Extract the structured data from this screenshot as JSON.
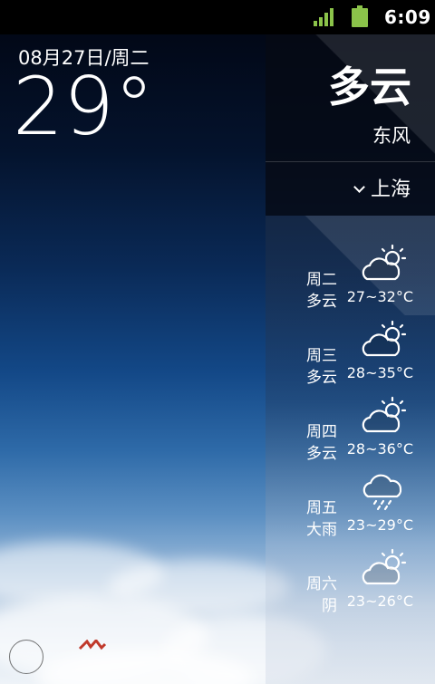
{
  "status_bar": {
    "time": "6:09",
    "signal_icon": "signal-bars-icon",
    "battery_icon": "battery-icon"
  },
  "current": {
    "date": "08月27日/周二",
    "temperature": "29°",
    "condition": "多云",
    "wind": "东风",
    "city": "上海"
  },
  "forecast": [
    {
      "day": "周二",
      "condition": "多云",
      "range": "27~32°C",
      "icon": "partly-cloudy-icon"
    },
    {
      "day": "周三",
      "condition": "多云",
      "range": "28~35°C",
      "icon": "partly-cloudy-icon"
    },
    {
      "day": "周四",
      "condition": "多云",
      "range": "28~36°C",
      "icon": "partly-cloudy-icon"
    },
    {
      "day": "周五",
      "condition": "大雨",
      "range": "23~29°C",
      "icon": "rain-cloud-icon"
    },
    {
      "day": "周六",
      "condition": "阴",
      "range": "23~26°C",
      "icon": "partly-cloudy-icon"
    }
  ],
  "colors": {
    "signal": "#8bc34a",
    "battery": "#8bc34a"
  }
}
